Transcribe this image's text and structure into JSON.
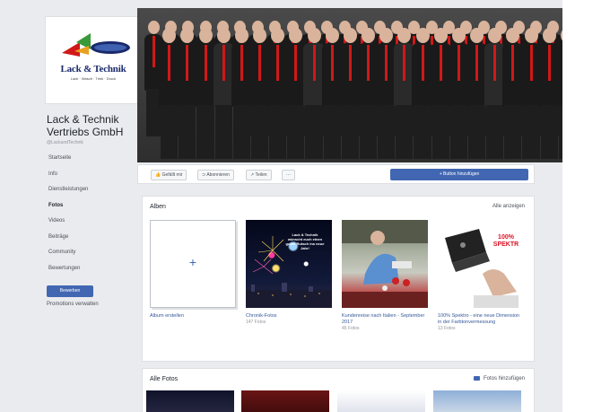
{
  "page": {
    "name_line1": "Lack & Technik",
    "name_line2": "Vertriebs GmbH",
    "handle": "@LackundTechnik"
  },
  "logo": {
    "text": "Lack & Technik",
    "sub": "Lack · Wasch · Trink · Druck"
  },
  "nav": {
    "items": [
      "Startseite",
      "Info",
      "Dienstleistungen",
      "Fotos",
      "Videos",
      "Beiträge",
      "Community",
      "Bewertungen"
    ],
    "active": "Fotos"
  },
  "promote": {
    "button": "Bewerben",
    "manage": "Promotions verwalten"
  },
  "actions": {
    "like": "Gefällt mir",
    "subscribe": "Abonnieren",
    "share": "Teilen",
    "more": "···",
    "add_button": "+ Button hinzufügen"
  },
  "albums": {
    "title": "Alben",
    "see_all": "Alle anzeigen",
    "items": [
      {
        "name": "Album erstellen",
        "count": ""
      },
      {
        "name": "Chronik-Fotos",
        "count": "147 Fotos",
        "overlay": "Lack & Technik wünscht euch einen guten Rutsch ins neue Jahr!"
      },
      {
        "name": "Kundenreise nach Italien - September 2017",
        "count": "45 Fotos"
      },
      {
        "name": "100% Spektro - eine neue Dimension in der Farbtonvermessung",
        "count": "13 Fotos",
        "overlay": "100% SPEKTR"
      }
    ],
    "create_plus": "+"
  },
  "all_photos": {
    "title": "Alle Fotos",
    "add": "Fotos hinzufügen"
  },
  "colors": {
    "brand": "#4267b2",
    "tie": "#d01818",
    "background": "#e9ebee"
  }
}
